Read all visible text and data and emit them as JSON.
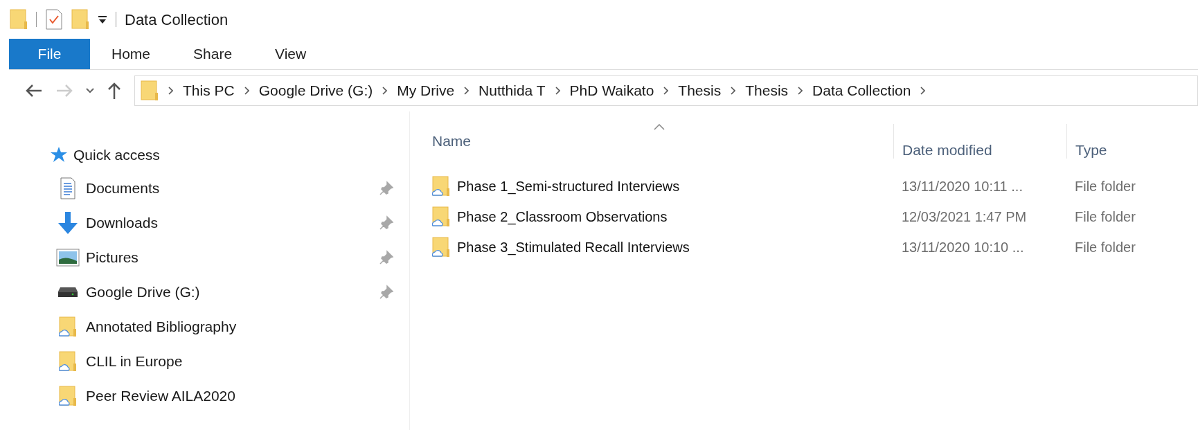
{
  "window": {
    "title": "Data Collection"
  },
  "ribbon_tabs": [
    {
      "label": "File",
      "selected": true
    },
    {
      "label": "Home",
      "selected": false
    },
    {
      "label": "Share",
      "selected": false
    },
    {
      "label": "View",
      "selected": false
    }
  ],
  "address_bar": {
    "path": [
      "This PC",
      "Google Drive (G:)",
      "My Drive",
      "Nutthida T",
      "PhD Waikato",
      "Thesis",
      "Thesis",
      "Data Collection"
    ]
  },
  "sidebar": {
    "header": "Quick access",
    "items": [
      {
        "label": "Documents",
        "kind": "documents",
        "pinned": true
      },
      {
        "label": "Downloads",
        "kind": "downloads",
        "pinned": true
      },
      {
        "label": "Pictures",
        "kind": "pictures",
        "pinned": true
      },
      {
        "label": "Google Drive (G:)",
        "kind": "drive",
        "pinned": true
      },
      {
        "label": "Annotated Bibliography",
        "kind": "cloud-folder",
        "pinned": false
      },
      {
        "label": "CLIL in Europe",
        "kind": "cloud-folder",
        "pinned": false
      },
      {
        "label": "Peer Review AILA2020",
        "kind": "cloud-folder",
        "pinned": false
      }
    ]
  },
  "table": {
    "columns": [
      "Name",
      "Date modified",
      "Type"
    ],
    "rows": [
      {
        "name": "Phase 1_Semi-structured Interviews",
        "date": "13/11/2020 10:11 ...",
        "type": "File folder"
      },
      {
        "name": "Phase 2_Classroom Observations",
        "date": "12/03/2021 1:47 PM",
        "type": "File folder"
      },
      {
        "name": "Phase 3_Stimulated Recall Interviews",
        "date": "13/11/2020 10:10 ...",
        "type": "File folder"
      }
    ]
  }
}
